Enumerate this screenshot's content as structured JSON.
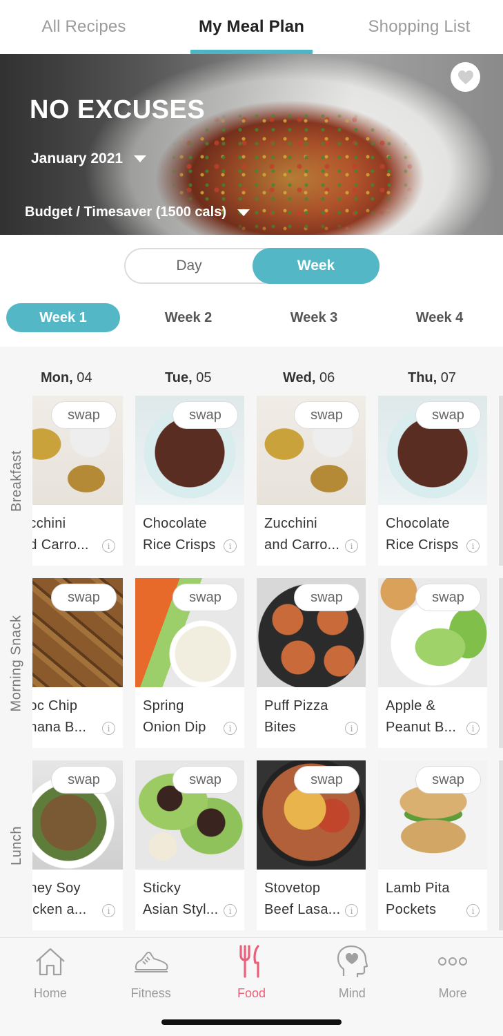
{
  "tabs": {
    "all_recipes": "All Recipes",
    "my_meal_plan": "My Meal Plan",
    "shopping_list": "Shopping List"
  },
  "hero": {
    "title": "NO EXCUSES",
    "month": "January 2021",
    "plan": "Budget / Timesaver (1500 cals)"
  },
  "view_toggle": {
    "day": "Day",
    "week": "Week",
    "selected": "Week"
  },
  "weeks": [
    "Week 1",
    "Week 2",
    "Week 3",
    "Week 4"
  ],
  "selected_week": "Week 1",
  "days": [
    {
      "dow": "Mon,",
      "date": "04"
    },
    {
      "dow": "Tue,",
      "date": "05"
    },
    {
      "dow": "Wed,",
      "date": "06"
    },
    {
      "dow": "Thu,",
      "date": "07"
    }
  ],
  "meals": [
    {
      "label": "Breakfast",
      "items": [
        {
          "line1": "ucchini",
          "line2": "nd Carro..."
        },
        {
          "line1": "Chocolate",
          "line2": "Rice Crisps"
        },
        {
          "line1": "Zucchini",
          "line2": "and Carro..."
        },
        {
          "line1": "Chocolate",
          "line2": "Rice Crisps"
        }
      ]
    },
    {
      "label": "Morning Snack",
      "items": [
        {
          "line1": "hoc Chip",
          "line2": "anana B..."
        },
        {
          "line1": "Spring",
          "line2": "Onion Dip"
        },
        {
          "line1": "Puff Pizza",
          "line2": "Bites"
        },
        {
          "line1": "Apple &",
          "line2": "Peanut B..."
        }
      ]
    },
    {
      "label": "Lunch",
      "items": [
        {
          "line1": "oney Soy",
          "line2": "hicken a..."
        },
        {
          "line1": "Sticky",
          "line2": "Asian Styl..."
        },
        {
          "line1": "Stovetop",
          "line2": "Beef Lasa..."
        },
        {
          "line1": "Lamb Pita",
          "line2": "Pockets"
        }
      ]
    }
  ],
  "swap_label": "swap",
  "info_glyph": "i",
  "nav": {
    "home": "Home",
    "fitness": "Fitness",
    "food": "Food",
    "mind": "Mind",
    "more": "More",
    "active": "Food"
  },
  "colors": {
    "accent": "#54b7c6",
    "food_active": "#e8607a"
  }
}
